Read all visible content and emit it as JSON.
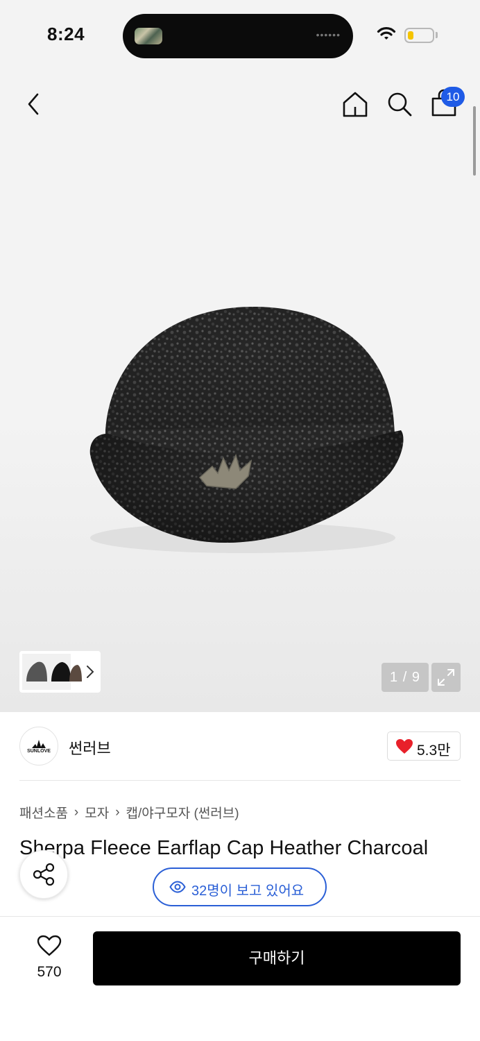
{
  "status_bar": {
    "time": "8:24",
    "battery_color": "#f5c400"
  },
  "header": {
    "back_icon": "chevron-left-icon",
    "home_icon": "home-icon",
    "search_icon": "search-icon",
    "cart_icon": "shopping-bag-icon",
    "cart_count": "10",
    "badge_color": "#1f5be6"
  },
  "gallery": {
    "counter": "1 / 9",
    "expand_icon": "expand-icon",
    "variant_chevron": "chevron-right-icon"
  },
  "brand": {
    "logo_text": "SUNLOVE",
    "name": "썬러브",
    "likes": "5.3만",
    "heart_color": "#e8202a"
  },
  "breadcrumb": [
    "패션소품",
    "모자",
    "캡/야구모자 (썬러브)"
  ],
  "product": {
    "title": "Sherpa Fleece Earflap Cap Heather Charcoal"
  },
  "viewers": {
    "text": "32명이 보고 있어요",
    "accent": "#2a5fd6"
  },
  "bottom_bar": {
    "wish_count": "570",
    "buy_label": "구매하기"
  }
}
